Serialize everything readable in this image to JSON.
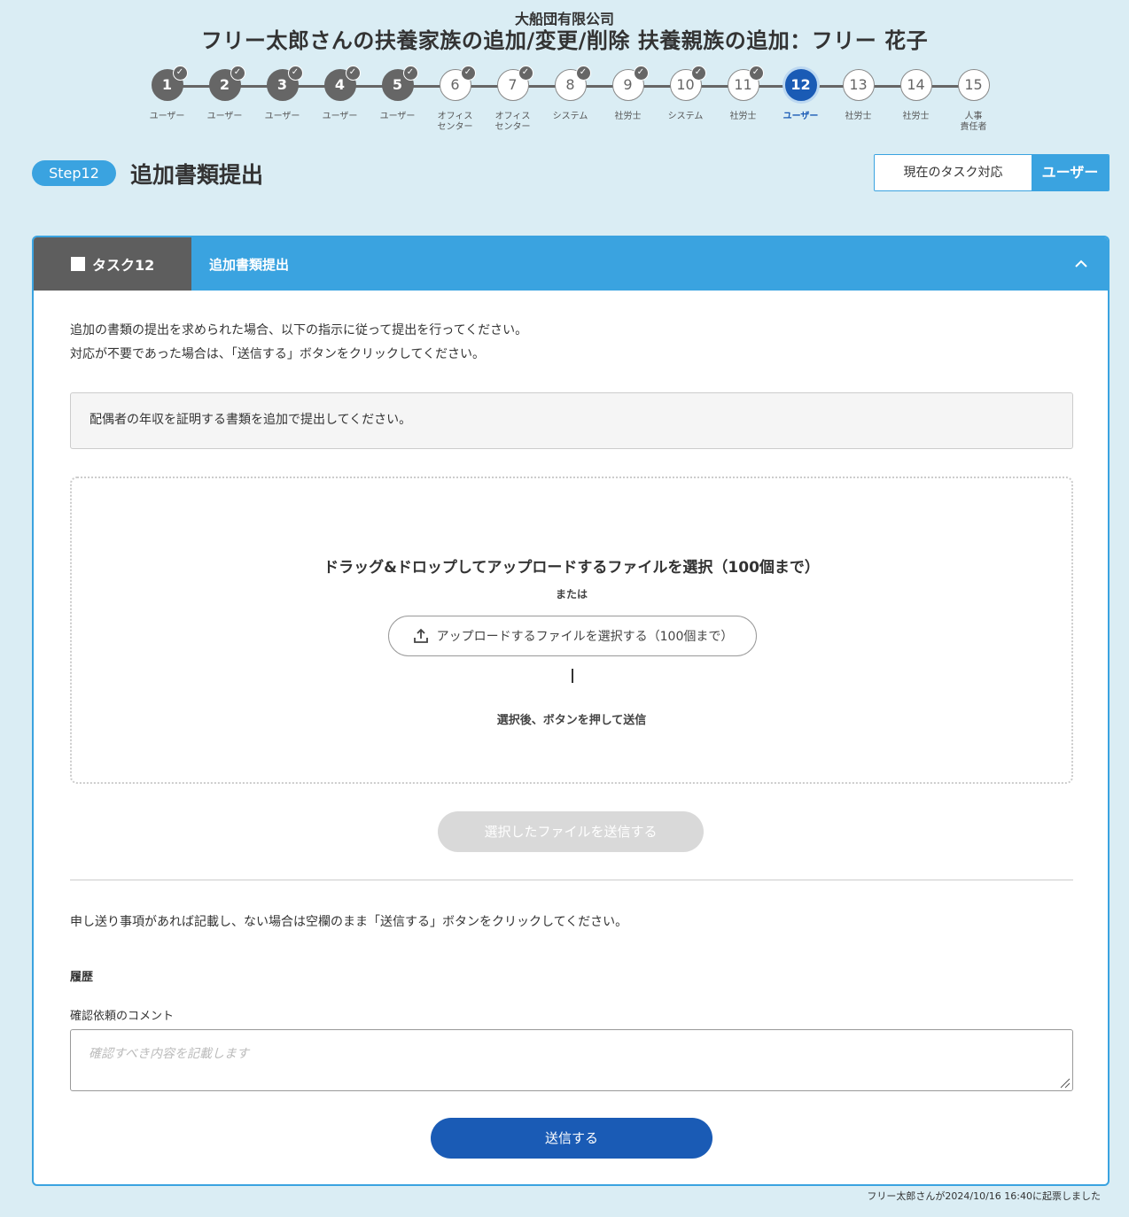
{
  "header": {
    "company": "大船団有限公司",
    "title": "フリー太郎さんの扶養家族の追加/変更/削除 扶養親族の追加：フリー 花子"
  },
  "stepper": {
    "steps": [
      {
        "number": "1",
        "label": "ユーザー",
        "status": "done"
      },
      {
        "number": "2",
        "label": "ユーザー",
        "status": "done"
      },
      {
        "number": "3",
        "label": "ユーザー",
        "status": "done"
      },
      {
        "number": "4",
        "label": "ユーザー",
        "status": "done"
      },
      {
        "number": "5",
        "label": "ユーザー",
        "status": "done"
      },
      {
        "number": "6",
        "label": "オフィス\nセンター",
        "status": "checked"
      },
      {
        "number": "7",
        "label": "オフィス\nセンター",
        "status": "checked"
      },
      {
        "number": "8",
        "label": "システム",
        "status": "checked"
      },
      {
        "number": "9",
        "label": "社労士",
        "status": "checked"
      },
      {
        "number": "10",
        "label": "システム",
        "status": "checked"
      },
      {
        "number": "11",
        "label": "社労士",
        "status": "checked"
      },
      {
        "number": "12",
        "label": "ユーザー",
        "status": "current"
      },
      {
        "number": "13",
        "label": "社労士",
        "status": "pending"
      },
      {
        "number": "14",
        "label": "社労士",
        "status": "pending"
      },
      {
        "number": "15",
        "label": "人事\n責任者",
        "status": "pending"
      }
    ]
  },
  "step": {
    "badge": "Step12",
    "heading": "追加書類提出"
  },
  "assignee": {
    "label": "現在のタスク対応",
    "value": "ユーザー"
  },
  "task": {
    "tab_label": "タスク12",
    "title": "追加書類提出",
    "instructions": [
      "追加の書類の提出を求められた場合、以下の指示に従って提出を行ってください。",
      "対応が不要であった場合は、「送信する」ボタンをクリックしてください。"
    ],
    "notice": "配偶者の年収を証明する書類を追加で提出してください。",
    "dropzone": {
      "title": "ドラッグ&ドロップしてアップロードするファイルを選択（100個まで）",
      "or": "または",
      "upload_button": "アップロードするファイルを選択する（100個まで）",
      "hint": "選択後、ボタンを押して送信"
    },
    "send_files_button": "選択したファイルを送信する",
    "note_text": "申し送り事項があれば記載し、ない場合は空欄のまま「送信する」ボタンをクリックしてください。",
    "history_label": "履歴",
    "comment_label": "確認依頼のコメント",
    "comment_placeholder": "確認すべき内容を記載します",
    "submit_button": "送信する"
  },
  "footer": {
    "note": "フリー太郎さんが2024/10/16 16:40に起票しました"
  },
  "colors": {
    "background": "#daedf4",
    "accent": "#3aa3e0",
    "primary": "#1a5bb5",
    "done": "#666666"
  }
}
